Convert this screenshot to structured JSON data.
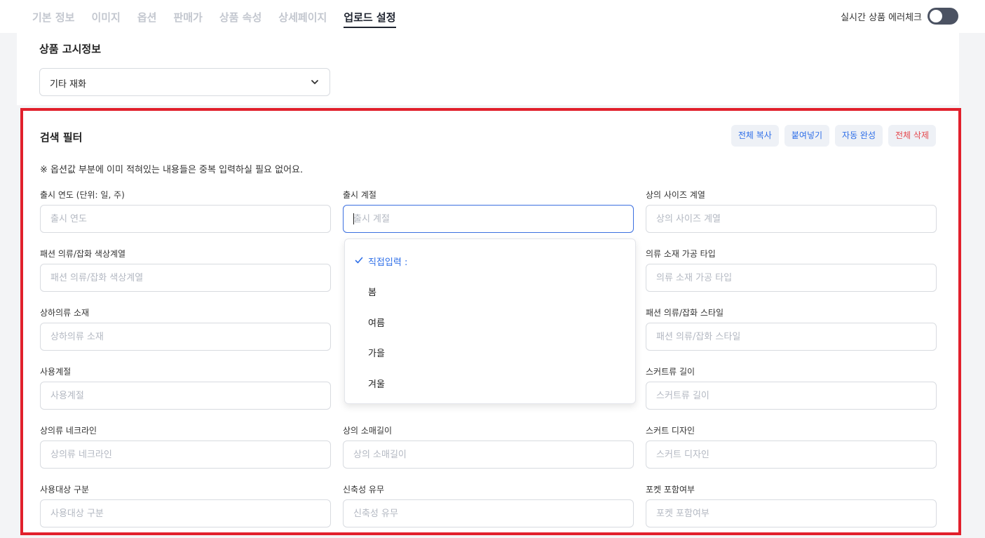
{
  "tabs": [
    {
      "label": "기본 정보",
      "active": false
    },
    {
      "label": "이미지",
      "active": false
    },
    {
      "label": "옵션",
      "active": false
    },
    {
      "label": "판매가",
      "active": false
    },
    {
      "label": "상품 속성",
      "active": false
    },
    {
      "label": "상세페이지",
      "active": false
    },
    {
      "label": "업로드 설정",
      "active": true
    }
  ],
  "error_check": {
    "label": "실시간 상품 에러체크",
    "enabled": false
  },
  "notice": {
    "title": "상품 고시정보",
    "selected": "기타 재화"
  },
  "filter": {
    "title": "검색 필터",
    "hint": "※ 옵션값 부분에 이미 적혀있는 내용들은 중복 입력하실 필요 없어요.",
    "actions": {
      "copy_all": "전체 복사",
      "paste": "붙여넣기",
      "autocomplete": "자동 완성",
      "delete_all": "전체 삭제"
    },
    "fields": [
      {
        "label": "출시 연도 (단위: 일, 주)",
        "placeholder": "출시 연도"
      },
      {
        "label": "출시 계절",
        "placeholder": "출시 계절"
      },
      {
        "label": "상의 사이즈 계열",
        "placeholder": "상의 사이즈 계열"
      },
      {
        "label": "패션 의류/잡화 색상계열",
        "placeholder": "패션 의류/잡화 색상계열"
      },
      {
        "label": "의류 소재 가공 타입",
        "placeholder": "의류 소재 가공 타입"
      },
      {
        "label": "상하의류 소재",
        "placeholder": "상하의류 소재"
      },
      {
        "label": "패션 의류/잡화 스타일",
        "placeholder": "패션 의류/잡화 스타일"
      },
      {
        "label": "사용계절",
        "placeholder": "사용계절"
      },
      {
        "label": "스커트류 길이",
        "placeholder": "스커트류 길이"
      },
      {
        "label": "상의류 네크라인",
        "placeholder": "상의류 네크라인"
      },
      {
        "label": "상의 소매길이",
        "placeholder": "상의 소매길이"
      },
      {
        "label": "스커트 디자인",
        "placeholder": "스커트 디자인"
      },
      {
        "label": "사용대상 구분",
        "placeholder": "사용대상 구분"
      },
      {
        "label": "신축성 유무",
        "placeholder": "신축성 유무"
      },
      {
        "label": "포켓 포함여부",
        "placeholder": "포켓 포함여부"
      }
    ],
    "dropdown": {
      "items": [
        {
          "label": "직접입력 :",
          "selected": true
        },
        {
          "label": "봄",
          "selected": false
        },
        {
          "label": "여름",
          "selected": false
        },
        {
          "label": "가을",
          "selected": false
        },
        {
          "label": "겨울",
          "selected": false
        }
      ]
    }
  },
  "colors": {
    "accent": "#2f6fe8",
    "danger": "#e5484d",
    "highlight_border": "#e1202c"
  }
}
